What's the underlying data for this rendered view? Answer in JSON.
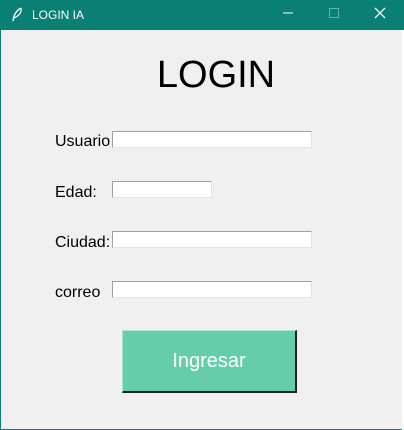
{
  "window": {
    "title": "LOGIN IA",
    "controls": {
      "minimize": "minimize",
      "maximize": "maximize",
      "close": "close"
    },
    "titlebar_color": "#0a7f74"
  },
  "form": {
    "heading": "LOGIN",
    "fields": [
      {
        "label": "Usuario",
        "value": ""
      },
      {
        "label": "Edad:",
        "value": ""
      },
      {
        "label": "Ciudad:",
        "value": ""
      },
      {
        "label": "correo",
        "value": ""
      }
    ],
    "submit_label": "Ingresar",
    "submit_color": "#66cdaa"
  },
  "icons": {
    "app": "feather-icon",
    "minimize": "minimize-icon",
    "maximize": "maximize-icon",
    "close": "close-icon"
  }
}
